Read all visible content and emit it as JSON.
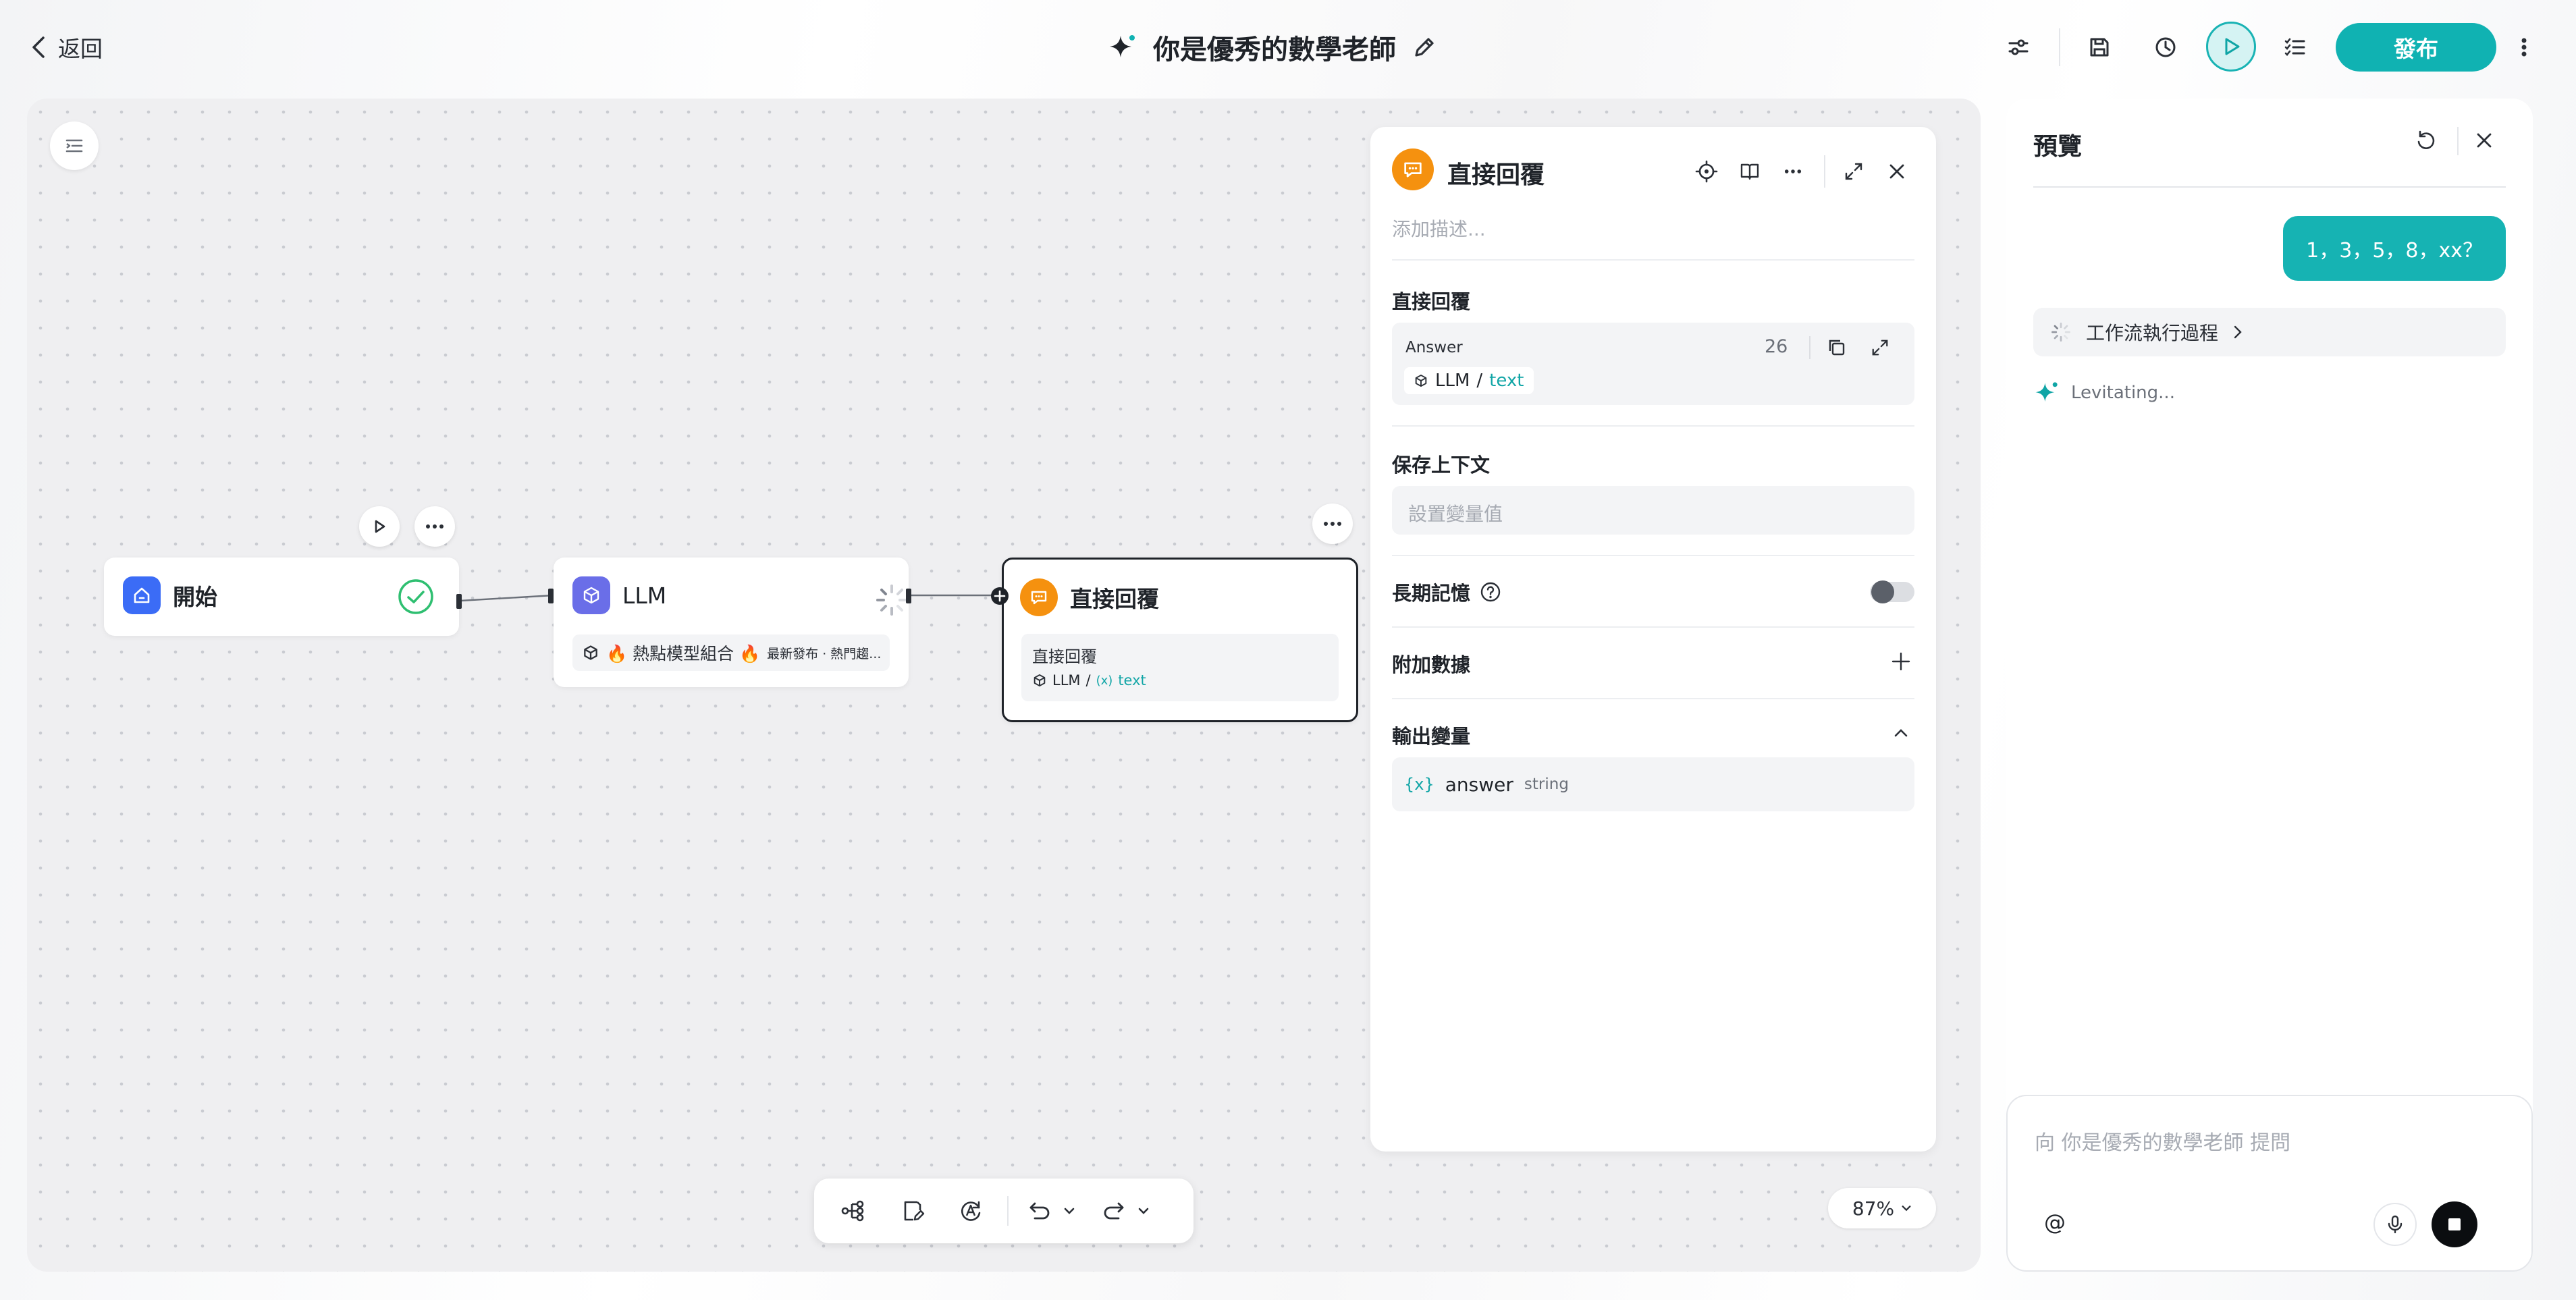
{
  "header": {
    "back_label": "返回",
    "title": "你是優秀的數學老師",
    "publish_label": "發布"
  },
  "canvas": {
    "zoom_label": "87%",
    "nodes": {
      "start": {
        "title": "開始"
      },
      "llm": {
        "title": "LLM",
        "model_label": "🔥 熱點模型組合 🔥",
        "model_tag": "最新發布 · 熱門趨..."
      },
      "answer": {
        "title": "直接回覆",
        "body_label": "直接回覆",
        "var_source": "LLM",
        "var_name": "text"
      }
    }
  },
  "panel": {
    "title": "直接回覆",
    "description_placeholder": "添加描述...",
    "answer_section": {
      "label": "直接回覆",
      "field_name": "Answer",
      "char_count": "26",
      "var_source": "LLM",
      "var_sep": "/",
      "var_name": "text"
    },
    "context_section": {
      "label": "保存上下文",
      "placeholder": "設置變量值"
    },
    "memory_section": {
      "label": "長期記憶",
      "enabled": false
    },
    "extra_data_section": {
      "label": "附加數據"
    },
    "output_section": {
      "label": "輸出變量",
      "var_name": "answer",
      "var_type": "string"
    }
  },
  "preview": {
    "title": "預覽",
    "user_message": "1，3，5，8，xx？",
    "workflow_label": "工作流執行過程",
    "status_text": "Levitating...",
    "input_placeholder": "向 你是優秀的數學老師 提問",
    "mention_label": "@"
  },
  "colors": {
    "accent": "#10b2b2",
    "start_node": "#3b6cf6",
    "llm_node": "#6a6ee8",
    "answer_node": "#f5910f",
    "success": "#2fbf71"
  }
}
